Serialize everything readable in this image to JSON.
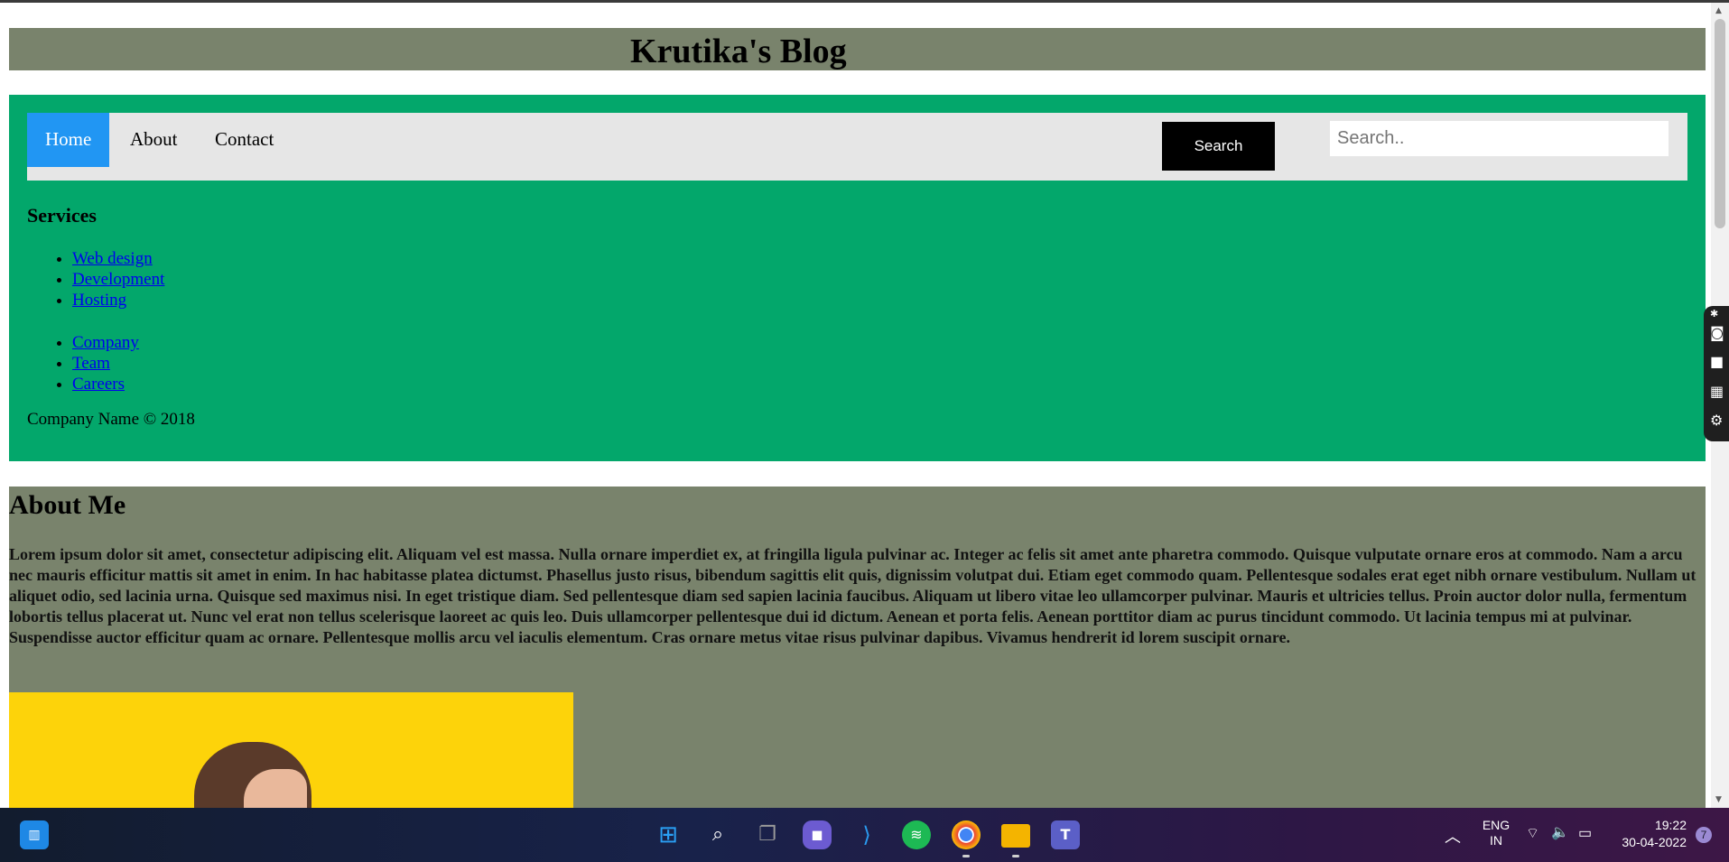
{
  "page": {
    "blog_title": "Krutika's Blog"
  },
  "nav": {
    "items": [
      {
        "label": "Home",
        "active": true
      },
      {
        "label": "About",
        "active": false
      },
      {
        "label": "Contact",
        "active": false
      }
    ],
    "search_button": "Search",
    "search_placeholder": "Search..",
    "search_value": ""
  },
  "services": {
    "title": "Services",
    "list1": [
      "Web design",
      "Development",
      "Hosting"
    ],
    "list2": [
      "Company",
      "Team",
      "Careers"
    ],
    "copyright": "Company Name © 2018"
  },
  "about": {
    "title": "About Me",
    "body": "Lorem ipsum dolor sit amet, consectetur adipiscing elit. Aliquam vel est massa. Nulla ornare imperdiet ex, at fringilla ligula pulvinar ac. Integer ac felis sit amet ante pharetra commodo. Quisque vulputate ornare eros at commodo. Nam a arcu nec mauris efficitur mattis sit amet in enim. In hac habitasse platea dictumst. Phasellus justo risus, bibendum sagittis elit quis, dignissim volutpat dui. Etiam eget commodo quam. Pellentesque sodales erat eget nibh ornare vestibulum. Nullam ut aliquet odio, sed lacinia urna. Quisque sed maximus nisi. In eget tristique diam. Sed pellentesque diam sed sapien lacinia faucibus. Aliquam ut libero vitae leo ullamcorper pulvinar. Mauris et ultricies tellus. Proin auctor dolor nulla, fermentum lobortis tellus placerat ut. Nunc vel erat non tellus scelerisque laoreet ac quis leo. Duis ullamcorper pellentesque dui id dictum. Aenean et porta felis. Aenean porttitor diam ac purus tincidunt commodo. Ut lacinia tempus mi at pulvinar. Suspendisse auctor efficitur quam ac ornare. Pellentesque mollis arcu vel iaculis elementum. Cras ornare metus vitae risus pulvinar dapibus. Vivamus hendrerit id lorem suscipit ornare."
  },
  "colors": {
    "header_bg": "#79836c",
    "nav_section_bg": "#03a76b",
    "navbar_bg": "#e6e6e6",
    "active_tab": "#2196f3",
    "photo_bg": "#fdd30a"
  },
  "side_toolbar": {
    "icons": [
      "camera-icon",
      "video-icon",
      "gallery-icon",
      "settings-icon"
    ]
  },
  "taskbar": {
    "apps": [
      "widgets-icon",
      "start-icon",
      "search-icon",
      "task-view-icon",
      "chat-icon",
      "vscode-icon",
      "spotify-icon",
      "chrome-icon",
      "file-explorer-icon",
      "teams-icon"
    ],
    "language_line1": "ENG",
    "language_line2": "IN",
    "time": "19:22",
    "date": "30-04-2022",
    "notification_count": "7"
  }
}
